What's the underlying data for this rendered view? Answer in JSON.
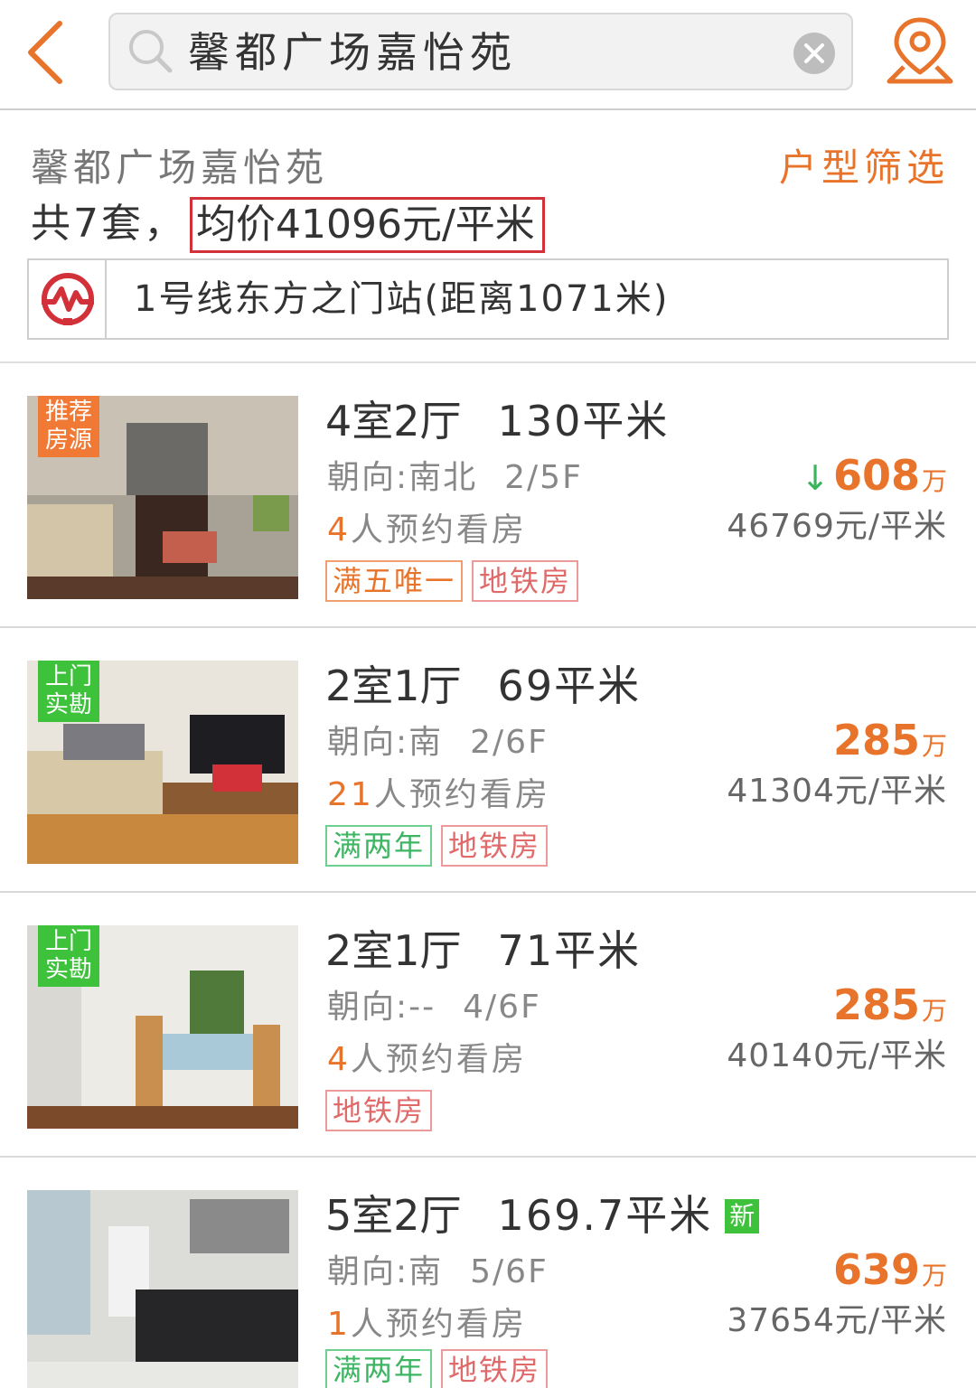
{
  "search": {
    "value": "馨都广场嘉怡苑"
  },
  "summary": {
    "community_name": "馨都广场嘉怡苑",
    "filter_label": "户型筛选",
    "count_text": "共7套，",
    "avg_price_text": "均价41096元/平米",
    "metro_text": "1号线东方之门站(距离1071米)"
  },
  "colors": {
    "accent": "#e8742c",
    "highlight_box": "#d3313a",
    "green_badge": "#3ec23b",
    "metro_red": "#d3313a"
  },
  "listings": [
    {
      "badge": "推荐房源",
      "badge_color": "orange",
      "layout": "4室2厅",
      "area": "130平米",
      "orientation": "朝向:南北",
      "floor": "2/5F",
      "viewers_num": "4",
      "viewers_text": "人预约看房",
      "price_arrow": "↓",
      "price": "608",
      "price_unit": "万",
      "unit_price": "46769元/平米",
      "tags": [
        {
          "label": "满五唯一",
          "style": "orange"
        },
        {
          "label": "地铁房",
          "style": "red"
        }
      ]
    },
    {
      "badge": "上门实勘",
      "badge_color": "green",
      "layout": "2室1厅",
      "area": "69平米",
      "orientation": "朝向:南",
      "floor": "2/6F",
      "viewers_num": "21",
      "viewers_text": "人预约看房",
      "price": "285",
      "price_unit": "万",
      "unit_price": "41304元/平米",
      "tags": [
        {
          "label": "满两年",
          "style": "green"
        },
        {
          "label": "地铁房",
          "style": "red"
        }
      ]
    },
    {
      "badge": "上门实勘",
      "badge_color": "green",
      "layout": "2室1厅",
      "area": "71平米",
      "orientation": "朝向:--",
      "floor": "4/6F",
      "viewers_num": "4",
      "viewers_text": "人预约看房",
      "price": "285",
      "price_unit": "万",
      "unit_price": "40140元/平米",
      "tags": [
        {
          "label": "地铁房",
          "style": "red"
        }
      ]
    },
    {
      "layout": "5室2厅",
      "area": "169.7平米",
      "new_badge": "新",
      "orientation": "朝向:南",
      "floor": "5/6F",
      "viewers_num": "1",
      "viewers_text": "人预约看房",
      "price": "639",
      "price_unit": "万",
      "unit_price": "37654元/平米",
      "tags": [
        {
          "label": "满两年",
          "style": "green"
        },
        {
          "label": "地铁房",
          "style": "red"
        }
      ]
    }
  ]
}
